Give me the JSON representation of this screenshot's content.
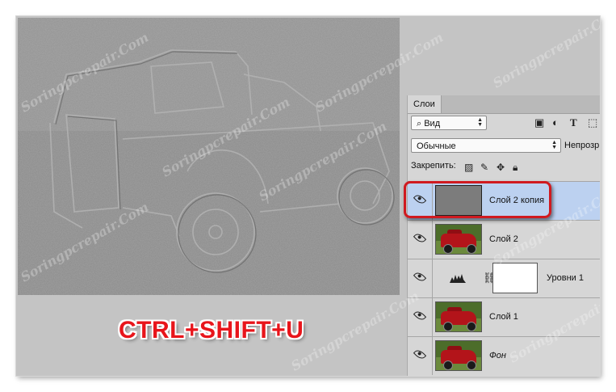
{
  "panel": {
    "tab_label": "Слои",
    "kind_filter": "Вид",
    "blend_mode": "Обычные",
    "opacity_label": "Непрозр",
    "lock_label": "Закрепить:"
  },
  "layers": [
    {
      "name": "Слой 2 копия",
      "selected": true
    },
    {
      "name": "Слой 2",
      "selected": false
    },
    {
      "name": "Уровни 1",
      "selected": false
    },
    {
      "name": "Слой 1",
      "selected": false
    },
    {
      "name": "Фон",
      "selected": false
    }
  ],
  "hotkey_caption": "CTRL+SHIFT+U",
  "watermark": "Soringpcrepair.Com",
  "colors": {
    "highlight": "#d01a20",
    "hotkey": "#e8151b",
    "selected_layer": "#bcd1f0"
  }
}
